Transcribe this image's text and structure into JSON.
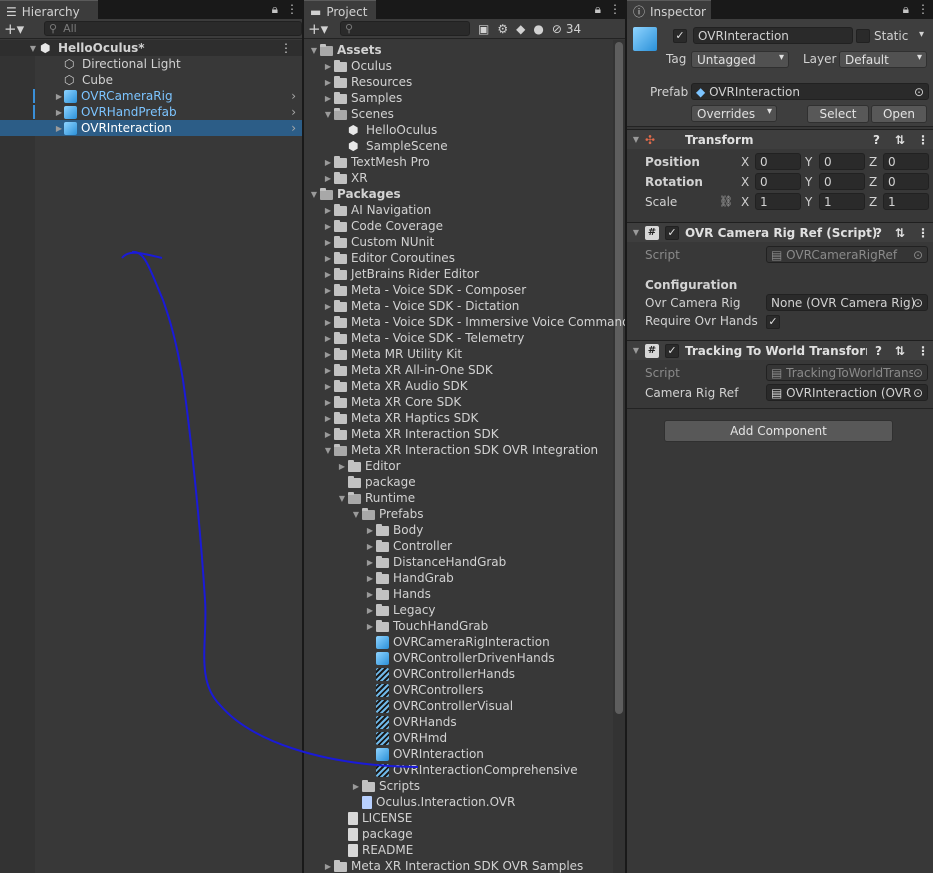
{
  "hierarchy": {
    "tab_label": "Hierarchy",
    "search_placeholder": "All",
    "scene": "HelloOculus*",
    "items": [
      {
        "label": "Directional Light",
        "color": "normal"
      },
      {
        "label": "Cube",
        "color": "normal"
      },
      {
        "label": "OVRCameraRig",
        "color": "blue"
      },
      {
        "label": "OVRHandPrefab",
        "color": "blue"
      },
      {
        "label": "OVRInteraction",
        "color": "selected"
      }
    ]
  },
  "project": {
    "tab_label": "Project",
    "hidden_count": "34",
    "tree": [
      {
        "label": "Assets",
        "indent": 0,
        "icon": "folder",
        "open": true,
        "bold": true
      },
      {
        "label": "Oculus",
        "indent": 1,
        "icon": "folder"
      },
      {
        "label": "Resources",
        "indent": 1,
        "icon": "folder"
      },
      {
        "label": "Samples",
        "indent": 1,
        "icon": "folder"
      },
      {
        "label": "Scenes",
        "indent": 1,
        "icon": "folder",
        "open": true
      },
      {
        "label": "HelloOculus",
        "indent": 2,
        "icon": "unity",
        "leaf": true
      },
      {
        "label": "SampleScene",
        "indent": 2,
        "icon": "unity",
        "leaf": true
      },
      {
        "label": "TextMesh Pro",
        "indent": 1,
        "icon": "folder"
      },
      {
        "label": "XR",
        "indent": 1,
        "icon": "folder"
      },
      {
        "label": "Packages",
        "indent": 0,
        "icon": "folder",
        "open": true,
        "bold": true
      },
      {
        "label": "AI Navigation",
        "indent": 1,
        "icon": "folder"
      },
      {
        "label": "Code Coverage",
        "indent": 1,
        "icon": "folder"
      },
      {
        "label": "Custom NUnit",
        "indent": 1,
        "icon": "folder"
      },
      {
        "label": "Editor Coroutines",
        "indent": 1,
        "icon": "folder"
      },
      {
        "label": "JetBrains Rider Editor",
        "indent": 1,
        "icon": "folder"
      },
      {
        "label": "Meta - Voice SDK - Composer",
        "indent": 1,
        "icon": "folder"
      },
      {
        "label": "Meta - Voice SDK - Dictation",
        "indent": 1,
        "icon": "folder"
      },
      {
        "label": "Meta - Voice SDK - Immersive Voice Commands",
        "indent": 1,
        "icon": "folder"
      },
      {
        "label": "Meta - Voice SDK - Telemetry",
        "indent": 1,
        "icon": "folder"
      },
      {
        "label": "Meta MR Utility Kit",
        "indent": 1,
        "icon": "folder"
      },
      {
        "label": "Meta XR All-in-One SDK",
        "indent": 1,
        "icon": "folder"
      },
      {
        "label": "Meta XR Audio SDK",
        "indent": 1,
        "icon": "folder"
      },
      {
        "label": "Meta XR Core SDK",
        "indent": 1,
        "icon": "folder"
      },
      {
        "label": "Meta XR Haptics SDK",
        "indent": 1,
        "icon": "folder"
      },
      {
        "label": "Meta XR Interaction SDK",
        "indent": 1,
        "icon": "folder"
      },
      {
        "label": "Meta XR Interaction SDK OVR Integration",
        "indent": 1,
        "icon": "folder",
        "open": true
      },
      {
        "label": "Editor",
        "indent": 2,
        "icon": "folder"
      },
      {
        "label": "package",
        "indent": 2,
        "icon": "folder",
        "leaf": true
      },
      {
        "label": "Runtime",
        "indent": 2,
        "icon": "folder",
        "open": true
      },
      {
        "label": "Prefabs",
        "indent": 3,
        "icon": "folder",
        "open": true
      },
      {
        "label": "Body",
        "indent": 4,
        "icon": "folder"
      },
      {
        "label": "Controller",
        "indent": 4,
        "icon": "folder"
      },
      {
        "label": "DistanceHandGrab",
        "indent": 4,
        "icon": "folder"
      },
      {
        "label": "HandGrab",
        "indent": 4,
        "icon": "folder"
      },
      {
        "label": "Hands",
        "indent": 4,
        "icon": "folder"
      },
      {
        "label": "Legacy",
        "indent": 4,
        "icon": "folder"
      },
      {
        "label": "TouchHandGrab",
        "indent": 4,
        "icon": "folder"
      },
      {
        "label": "OVRCameraRigInteraction",
        "indent": 4,
        "icon": "prefab",
        "leaf": true
      },
      {
        "label": "OVRControllerDrivenHands",
        "indent": 4,
        "icon": "prefab",
        "leaf": true
      },
      {
        "label": "OVRControllerHands",
        "indent": 4,
        "icon": "variant",
        "leaf": true
      },
      {
        "label": "OVRControllers",
        "indent": 4,
        "icon": "variant",
        "leaf": true
      },
      {
        "label": "OVRControllerVisual",
        "indent": 4,
        "icon": "variant",
        "leaf": true
      },
      {
        "label": "OVRHands",
        "indent": 4,
        "icon": "variant",
        "leaf": true
      },
      {
        "label": "OVRHmd",
        "indent": 4,
        "icon": "variant",
        "leaf": true
      },
      {
        "label": "OVRInteraction",
        "indent": 4,
        "icon": "prefab",
        "leaf": true
      },
      {
        "label": "OVRInteractionComprehensive",
        "indent": 4,
        "icon": "variant",
        "leaf": true
      },
      {
        "label": "Scripts",
        "indent": 3,
        "icon": "folder"
      },
      {
        "label": "Oculus.Interaction.OVR",
        "indent": 3,
        "icon": "asmdef",
        "leaf": true
      },
      {
        "label": "LICENSE",
        "indent": 2,
        "icon": "doc",
        "leaf": true
      },
      {
        "label": "package",
        "indent": 2,
        "icon": "doc",
        "leaf": true
      },
      {
        "label": "README",
        "indent": 2,
        "icon": "doc",
        "leaf": true
      },
      {
        "label": "Meta XR Interaction SDK OVR Samples",
        "indent": 1,
        "icon": "folder"
      }
    ]
  },
  "inspector": {
    "tab_label": "Inspector",
    "object_name": "OVRInteraction",
    "static_label": "Static",
    "tag_label": "Tag",
    "tag_value": "Untagged",
    "layer_label": "Layer",
    "layer_value": "Default",
    "prefab_label": "Prefab",
    "prefab_value": "OVRInteraction",
    "overrides_label": "Overrides",
    "select_label": "Select",
    "open_label": "Open",
    "transform": {
      "title": "Transform",
      "position_label": "Position",
      "rotation_label": "Rotation",
      "scale_label": "Scale",
      "position": [
        "0",
        "0",
        "0"
      ],
      "rotation": [
        "0",
        "0",
        "0"
      ],
      "scale": [
        "1",
        "1",
        "1"
      ],
      "x": "X",
      "y": "Y",
      "z": "Z"
    },
    "comp1": {
      "title": "OVR Camera Rig Ref (Script)",
      "script_label": "Script",
      "script_value": "OVRCameraRigRef",
      "config_label": "Configuration",
      "rig_label": "Ovr Camera Rig",
      "rig_value": "None (OVR Camera Rig)",
      "hands_label": "Require Ovr Hands"
    },
    "comp2": {
      "title": "Tracking To World Transformer",
      "script_label": "Script",
      "script_value": "TrackingToWorldTrans",
      "ref_label": "Camera Rig Ref",
      "ref_value": "OVRInteraction (OVR C"
    },
    "add_component": "Add Component"
  }
}
